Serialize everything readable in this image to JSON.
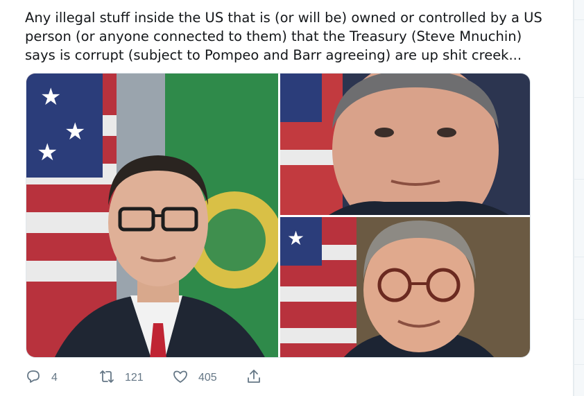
{
  "tweet": {
    "text": "Any illegal stuff inside the US that is (or will be) owned or controlled by a US person (or anyone connected to them) that the Treasury (Steve Mnuchin) says is corrupt (subject to Pompeo and Barr agreeing) are up shit creek..."
  },
  "media": {
    "photos": [
      {
        "subject": "man in dark suit with red tie and glasses in front of US flag and green seal"
      },
      {
        "subject": "man with grey hair in front of flags"
      },
      {
        "subject": "man with glasses smiling in dark suit in front of US flag"
      }
    ]
  },
  "actions": {
    "reply": {
      "icon": "reply-icon",
      "count": "4"
    },
    "retweet": {
      "icon": "retweet-icon",
      "count": "121"
    },
    "like": {
      "icon": "heart-icon",
      "count": "405"
    },
    "share": {
      "icon": "share-icon"
    }
  },
  "colors": {
    "text": "#14171a",
    "secondary": "#657786",
    "border": "#e1e8ed"
  }
}
